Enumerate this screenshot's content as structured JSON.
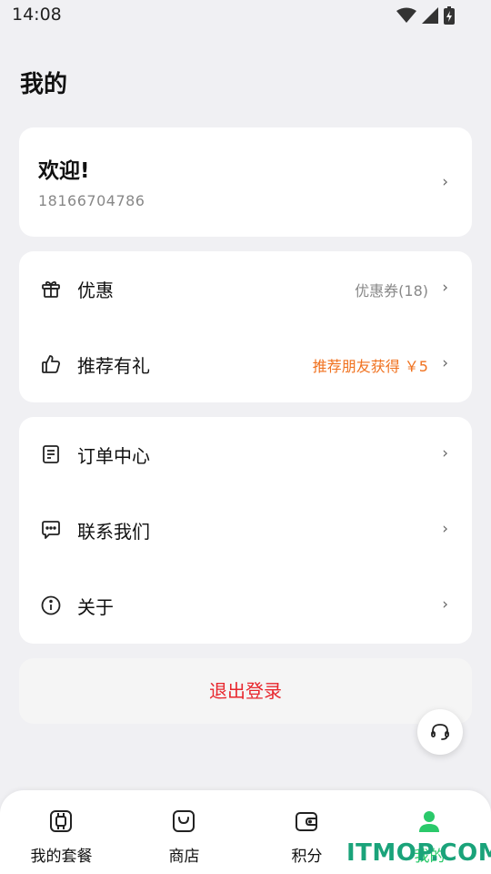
{
  "status_bar": {
    "time": "14:08"
  },
  "page": {
    "title": "我的"
  },
  "welcome": {
    "title": "欢迎!",
    "phone": "18166704786"
  },
  "menu_group_1": [
    {
      "label": "优惠",
      "extra": "优惠券(18)",
      "extra_color": "#888888",
      "icon": "gift-icon"
    },
    {
      "label": "推荐有礼",
      "extra": "推荐朋友获得 ￥5",
      "extra_color": "#f0711e",
      "icon": "thumbs-up-icon"
    }
  ],
  "menu_group_2": [
    {
      "label": "订单中心",
      "icon": "order-document-icon"
    },
    {
      "label": "联系我们",
      "icon": "chat-bubble-icon"
    },
    {
      "label": "关于",
      "icon": "info-icon"
    }
  ],
  "logout": {
    "label": "退出登录",
    "color": "#e8262d"
  },
  "tabs": [
    {
      "label": "我的套餐",
      "icon": "sim-chip-icon",
      "active": false
    },
    {
      "label": "商店",
      "icon": "shopping-bag-icon",
      "active": false
    },
    {
      "label": "积分",
      "icon": "wallet-icon",
      "active": false
    },
    {
      "label": "我的",
      "icon": "user-icon",
      "active": true
    }
  ],
  "watermark": "ITMOP.COM",
  "colors": {
    "accent": "#2ac96a",
    "background": "#f0f0f3"
  }
}
